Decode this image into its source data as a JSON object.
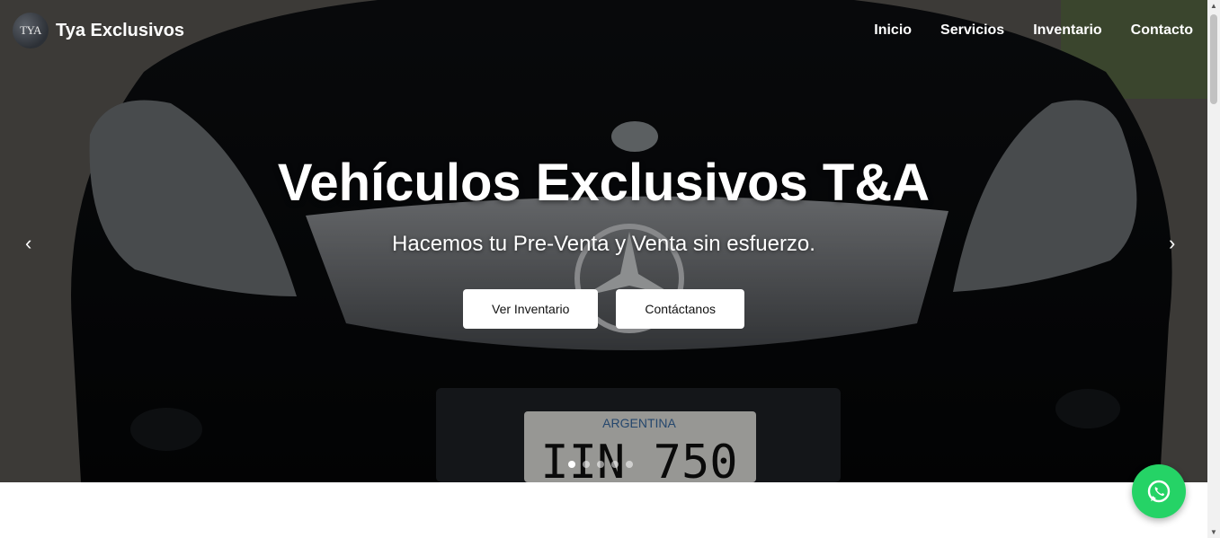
{
  "brand": {
    "logo_text": "TYA",
    "name": "Tya Exclusivos"
  },
  "nav": {
    "items": [
      "Inicio",
      "Servicios",
      "Inventario",
      "Contacto"
    ]
  },
  "hero": {
    "title": "Vehículos Exclusivos T&A",
    "subtitle": "Hacemos tu Pre-Venta y Venta sin esfuerzo.",
    "buttons": {
      "inventory": "Ver Inventario",
      "contact": "Contáctanos"
    },
    "prev_icon": "chevron-left-icon",
    "next_icon": "chevron-right-icon",
    "slides_count": 5,
    "active_slide": 1,
    "plate": {
      "country": "ARGENTINA",
      "number": "IIN 750"
    }
  },
  "floating": {
    "icon": "whatsapp-icon",
    "color": "#25d366"
  }
}
